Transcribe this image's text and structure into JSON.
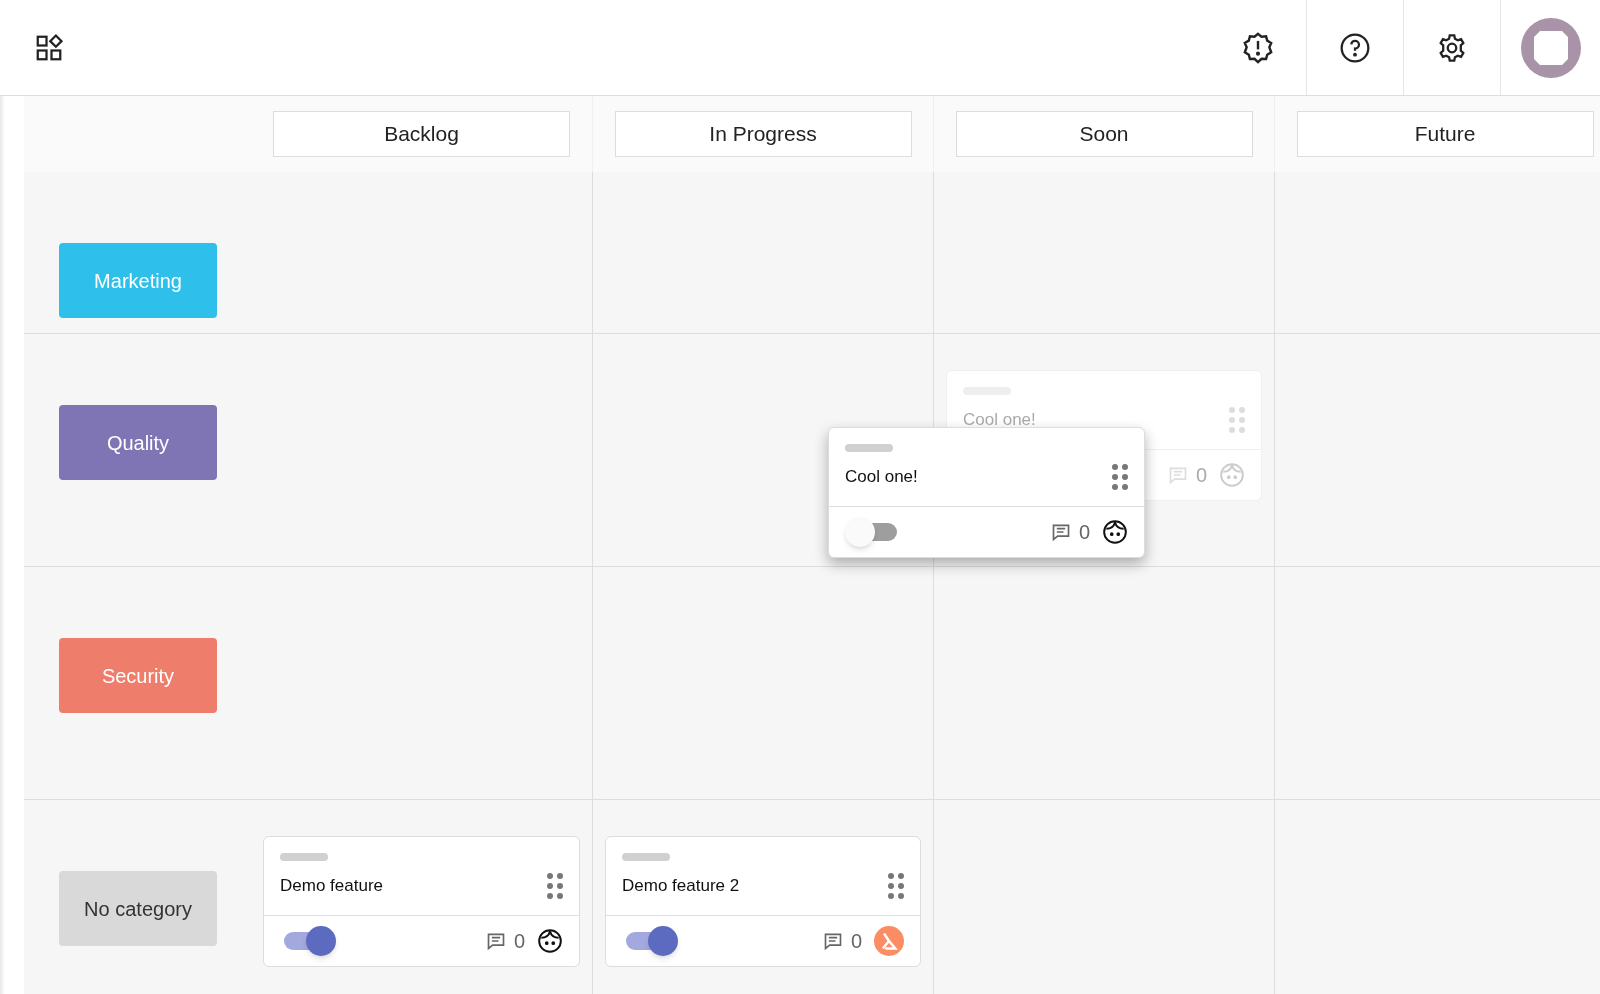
{
  "columns": [
    "Backlog",
    "In Progress",
    "Soon",
    "Future"
  ],
  "rows": [
    {
      "label": "Marketing",
      "color": "#2ebfea",
      "cells": [
        [],
        [],
        [],
        []
      ]
    },
    {
      "label": "Quality",
      "color": "#7f75b4",
      "cells": [
        [],
        [],
        [
          {
            "title": "Cool one!",
            "comments": "0",
            "avatar": {
              "kind": "face"
            },
            "ghost": true
          }
        ],
        []
      ]
    },
    {
      "label": "Security",
      "color": "#ef7d6c",
      "cells": [
        [],
        [],
        [],
        []
      ]
    },
    {
      "label": "No category",
      "color": "#d9d9d9",
      "cells": [
        [
          {
            "title": "Demo feature",
            "on": true,
            "comments": "0",
            "avatar": {
              "kind": "face"
            },
            "ghost": false
          }
        ],
        [
          {
            "title": "Demo feature 2",
            "on": true,
            "comments": "0",
            "avatar": {
              "kind": "logo"
            },
            "ghost": false
          }
        ],
        [],
        []
      ]
    }
  ],
  "drag_preview": {
    "title": "Cool one!",
    "on": false,
    "comments": "0",
    "avatar": {
      "kind": "face"
    }
  }
}
